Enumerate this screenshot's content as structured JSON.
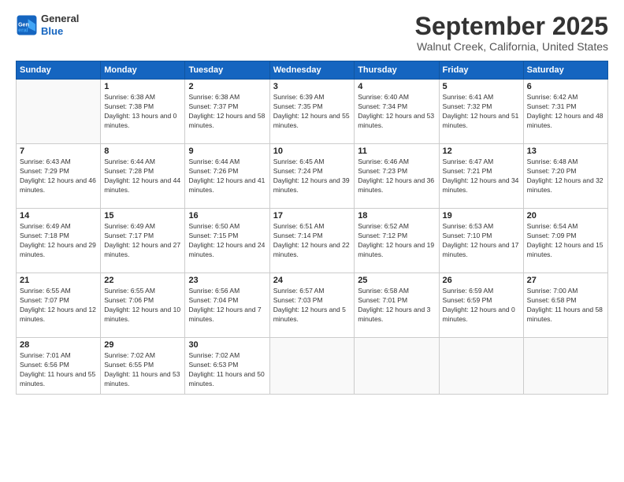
{
  "logo": {
    "line1": "General",
    "line2": "Blue"
  },
  "header": {
    "month": "September 2025",
    "location": "Walnut Creek, California, United States"
  },
  "weekdays": [
    "Sunday",
    "Monday",
    "Tuesday",
    "Wednesday",
    "Thursday",
    "Friday",
    "Saturday"
  ],
  "weeks": [
    [
      {
        "day": "",
        "sunrise": "",
        "sunset": "",
        "daylight": ""
      },
      {
        "day": "1",
        "sunrise": "Sunrise: 6:38 AM",
        "sunset": "Sunset: 7:38 PM",
        "daylight": "Daylight: 13 hours and 0 minutes."
      },
      {
        "day": "2",
        "sunrise": "Sunrise: 6:38 AM",
        "sunset": "Sunset: 7:37 PM",
        "daylight": "Daylight: 12 hours and 58 minutes."
      },
      {
        "day": "3",
        "sunrise": "Sunrise: 6:39 AM",
        "sunset": "Sunset: 7:35 PM",
        "daylight": "Daylight: 12 hours and 55 minutes."
      },
      {
        "day": "4",
        "sunrise": "Sunrise: 6:40 AM",
        "sunset": "Sunset: 7:34 PM",
        "daylight": "Daylight: 12 hours and 53 minutes."
      },
      {
        "day": "5",
        "sunrise": "Sunrise: 6:41 AM",
        "sunset": "Sunset: 7:32 PM",
        "daylight": "Daylight: 12 hours and 51 minutes."
      },
      {
        "day": "6",
        "sunrise": "Sunrise: 6:42 AM",
        "sunset": "Sunset: 7:31 PM",
        "daylight": "Daylight: 12 hours and 48 minutes."
      }
    ],
    [
      {
        "day": "7",
        "sunrise": "Sunrise: 6:43 AM",
        "sunset": "Sunset: 7:29 PM",
        "daylight": "Daylight: 12 hours and 46 minutes."
      },
      {
        "day": "8",
        "sunrise": "Sunrise: 6:44 AM",
        "sunset": "Sunset: 7:28 PM",
        "daylight": "Daylight: 12 hours and 44 minutes."
      },
      {
        "day": "9",
        "sunrise": "Sunrise: 6:44 AM",
        "sunset": "Sunset: 7:26 PM",
        "daylight": "Daylight: 12 hours and 41 minutes."
      },
      {
        "day": "10",
        "sunrise": "Sunrise: 6:45 AM",
        "sunset": "Sunset: 7:24 PM",
        "daylight": "Daylight: 12 hours and 39 minutes."
      },
      {
        "day": "11",
        "sunrise": "Sunrise: 6:46 AM",
        "sunset": "Sunset: 7:23 PM",
        "daylight": "Daylight: 12 hours and 36 minutes."
      },
      {
        "day": "12",
        "sunrise": "Sunrise: 6:47 AM",
        "sunset": "Sunset: 7:21 PM",
        "daylight": "Daylight: 12 hours and 34 minutes."
      },
      {
        "day": "13",
        "sunrise": "Sunrise: 6:48 AM",
        "sunset": "Sunset: 7:20 PM",
        "daylight": "Daylight: 12 hours and 32 minutes."
      }
    ],
    [
      {
        "day": "14",
        "sunrise": "Sunrise: 6:49 AM",
        "sunset": "Sunset: 7:18 PM",
        "daylight": "Daylight: 12 hours and 29 minutes."
      },
      {
        "day": "15",
        "sunrise": "Sunrise: 6:49 AM",
        "sunset": "Sunset: 7:17 PM",
        "daylight": "Daylight: 12 hours and 27 minutes."
      },
      {
        "day": "16",
        "sunrise": "Sunrise: 6:50 AM",
        "sunset": "Sunset: 7:15 PM",
        "daylight": "Daylight: 12 hours and 24 minutes."
      },
      {
        "day": "17",
        "sunrise": "Sunrise: 6:51 AM",
        "sunset": "Sunset: 7:14 PM",
        "daylight": "Daylight: 12 hours and 22 minutes."
      },
      {
        "day": "18",
        "sunrise": "Sunrise: 6:52 AM",
        "sunset": "Sunset: 7:12 PM",
        "daylight": "Daylight: 12 hours and 19 minutes."
      },
      {
        "day": "19",
        "sunrise": "Sunrise: 6:53 AM",
        "sunset": "Sunset: 7:10 PM",
        "daylight": "Daylight: 12 hours and 17 minutes."
      },
      {
        "day": "20",
        "sunrise": "Sunrise: 6:54 AM",
        "sunset": "Sunset: 7:09 PM",
        "daylight": "Daylight: 12 hours and 15 minutes."
      }
    ],
    [
      {
        "day": "21",
        "sunrise": "Sunrise: 6:55 AM",
        "sunset": "Sunset: 7:07 PM",
        "daylight": "Daylight: 12 hours and 12 minutes."
      },
      {
        "day": "22",
        "sunrise": "Sunrise: 6:55 AM",
        "sunset": "Sunset: 7:06 PM",
        "daylight": "Daylight: 12 hours and 10 minutes."
      },
      {
        "day": "23",
        "sunrise": "Sunrise: 6:56 AM",
        "sunset": "Sunset: 7:04 PM",
        "daylight": "Daylight: 12 hours and 7 minutes."
      },
      {
        "day": "24",
        "sunrise": "Sunrise: 6:57 AM",
        "sunset": "Sunset: 7:03 PM",
        "daylight": "Daylight: 12 hours and 5 minutes."
      },
      {
        "day": "25",
        "sunrise": "Sunrise: 6:58 AM",
        "sunset": "Sunset: 7:01 PM",
        "daylight": "Daylight: 12 hours and 3 minutes."
      },
      {
        "day": "26",
        "sunrise": "Sunrise: 6:59 AM",
        "sunset": "Sunset: 6:59 PM",
        "daylight": "Daylight: 12 hours and 0 minutes."
      },
      {
        "day": "27",
        "sunrise": "Sunrise: 7:00 AM",
        "sunset": "Sunset: 6:58 PM",
        "daylight": "Daylight: 11 hours and 58 minutes."
      }
    ],
    [
      {
        "day": "28",
        "sunrise": "Sunrise: 7:01 AM",
        "sunset": "Sunset: 6:56 PM",
        "daylight": "Daylight: 11 hours and 55 minutes."
      },
      {
        "day": "29",
        "sunrise": "Sunrise: 7:02 AM",
        "sunset": "Sunset: 6:55 PM",
        "daylight": "Daylight: 11 hours and 53 minutes."
      },
      {
        "day": "30",
        "sunrise": "Sunrise: 7:02 AM",
        "sunset": "Sunset: 6:53 PM",
        "daylight": "Daylight: 11 hours and 50 minutes."
      },
      {
        "day": "",
        "sunrise": "",
        "sunset": "",
        "daylight": ""
      },
      {
        "day": "",
        "sunrise": "",
        "sunset": "",
        "daylight": ""
      },
      {
        "day": "",
        "sunrise": "",
        "sunset": "",
        "daylight": ""
      },
      {
        "day": "",
        "sunrise": "",
        "sunset": "",
        "daylight": ""
      }
    ]
  ]
}
